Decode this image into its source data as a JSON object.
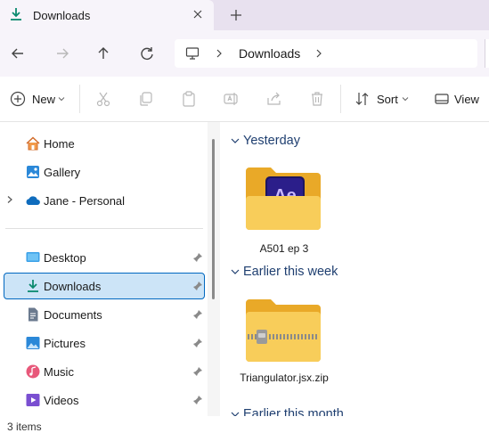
{
  "tab": {
    "title": "Downloads"
  },
  "address": {
    "location": "Downloads"
  },
  "toolbar": {
    "new_label": "New",
    "sort_label": "Sort",
    "view_label": "View"
  },
  "nav": {
    "items": [
      {
        "label": "Home",
        "icon": "home-icon"
      },
      {
        "label": "Gallery",
        "icon": "gallery-icon"
      },
      {
        "label": "Jane - Personal",
        "icon": "onedrive-cloud-icon"
      },
      {
        "label": "Desktop",
        "icon": "desktop-icon"
      },
      {
        "label": "Downloads",
        "icon": "download-icon",
        "selected": true
      },
      {
        "label": "Documents",
        "icon": "documents-icon"
      },
      {
        "label": "Pictures",
        "icon": "pictures-icon"
      },
      {
        "label": "Music",
        "icon": "music-icon"
      },
      {
        "label": "Videos",
        "icon": "videos-icon"
      }
    ]
  },
  "groups": [
    {
      "title": "Yesterday",
      "files": [
        {
          "name": "A501 ep 3",
          "type": "folder-ae"
        }
      ]
    },
    {
      "title": "Earlier this week",
      "files": [
        {
          "name": "Triangulator.jsx.zip",
          "type": "zip"
        }
      ]
    },
    {
      "title": "Earlier this month",
      "files": []
    }
  ],
  "status": {
    "text": "3 items"
  },
  "colors": {
    "accent": "#0a8a6e",
    "selected_bg": "#cce4f7",
    "selected_border": "#0067c0",
    "folder": "#f8c542",
    "group_header": "#1f3f70"
  }
}
